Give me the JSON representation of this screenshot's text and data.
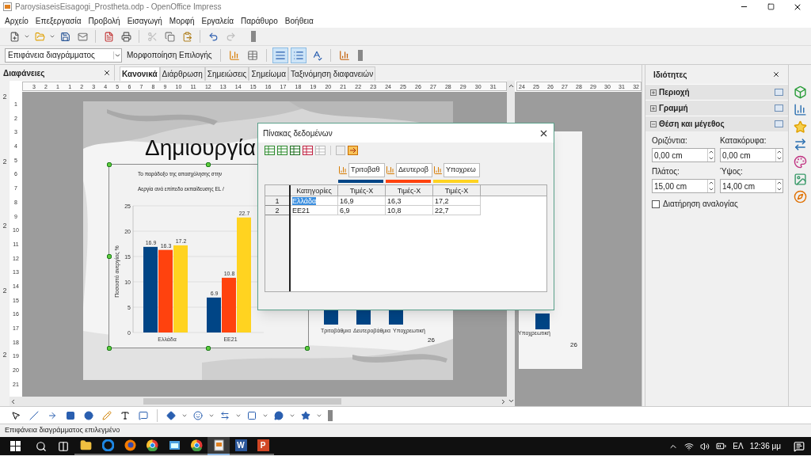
{
  "window": {
    "title": "ParoysiaseisEisagogi_Prostheta.odp - OpenOffice Impress"
  },
  "menu": [
    "Αρχείο",
    "Επεξεργασία",
    "Προβολή",
    "Εισαγωγή",
    "Μορφή",
    "Εργαλεία",
    "Παράθυρο",
    "Βοήθεια"
  ],
  "format_toolbar": {
    "object_select": "Επιφάνεια διαγράμματος",
    "format_selection": "Μορφοποίηση Επιλογής",
    "toggles": [
      {
        "kind": "chart-type",
        "selected": false
      },
      {
        "kind": "data-table",
        "selected": false
      },
      {
        "kind": "horizontal-grid",
        "selected": true
      },
      {
        "kind": "legend",
        "selected": true
      },
      {
        "kind": "text-scale",
        "selected": false
      },
      {
        "kind": "chart-wizard",
        "selected": false
      }
    ]
  },
  "slides_pane": {
    "title": "Διαφάνειες",
    "slide_numbers": [
      "2",
      "2",
      "2",
      "2",
      "2"
    ]
  },
  "view_tabs": [
    {
      "label": "Κανονικά",
      "selected": true
    },
    {
      "label": "Διάρθρωση",
      "selected": false
    },
    {
      "label": "Σημειώσεις",
      "selected": false
    },
    {
      "label": "Σημείωμα",
      "selected": false
    },
    {
      "label": "Ταξινόμηση διαφανειών",
      "selected": false
    }
  ],
  "ruler_h": [
    "3",
    "2",
    "1",
    "1",
    "2",
    "3",
    "4",
    "5",
    "6",
    "7",
    "8",
    "9",
    "10",
    "11",
    "12",
    "13",
    "14",
    "15",
    "16",
    "17",
    "18",
    "19",
    "20",
    "21",
    "22",
    "23",
    "24",
    "25",
    "26",
    "27",
    "28",
    "29",
    "30",
    "31"
  ],
  "ruler_v": [
    "1",
    "2",
    "3",
    "4",
    "5",
    "6",
    "7",
    "8",
    "9",
    "10",
    "11",
    "12",
    "13",
    "14",
    "15",
    "16",
    "17",
    "18",
    "19",
    "20",
    "21"
  ],
  "slide": {
    "title": "Δημιουργία",
    "chart": {
      "title": "Το παράδοξο της απασχόλησης στην",
      "subtitle": "Αεργία ανά επίπεδο εκπαίδευσης EL /",
      "chart_data": {
        "type": "bar",
        "ylabel": "Ποσοστό ανεργίας %",
        "categories": [
          "Ελλάδα",
          "ΕΕ21"
        ],
        "ylim": [
          0,
          25
        ],
        "yticks": [
          0,
          5,
          10,
          15,
          20,
          25
        ],
        "data_labels": true,
        "grid": true,
        "series": [
          {
            "color": "#004586",
            "values": [
              16.9,
              6.9
            ]
          },
          {
            "color": "#ff420e",
            "values": [
              16.3,
              10.8
            ]
          },
          {
            "color": "#ffd320",
            "values": [
              17.2,
              22.7
            ]
          }
        ]
      }
    },
    "second_chart": {
      "categories": [
        "Τριτοβάθμια",
        "Δευτεροβάθμια",
        "Υποχρεωτική"
      ],
      "page_number": "26"
    }
  },
  "second_view": {
    "ruler": [
      "24",
      "25",
      "26",
      "27",
      "28",
      "29",
      "30",
      "31",
      "32"
    ],
    "category": "Υποχρεωτική",
    "page_number": "26"
  },
  "dialog": {
    "title": "Πίνακας δεδομένων",
    "first_column": "Κατηγορίες",
    "series": [
      {
        "name": "Τριτοβαθ",
        "color": "#004586",
        "column_label": "Τιμές-Χ"
      },
      {
        "name": "Δευτεροβ",
        "color": "#ff420e",
        "column_label": "Τιμές-Χ"
      },
      {
        "name": "Υποχρεω",
        "color": "#ffd320",
        "column_label": "Τιμές-Χ"
      }
    ],
    "rows": [
      {
        "number": "1",
        "cells": [
          {
            "text": "Ελλάδα",
            "selected": true
          },
          {
            "text": "16,9",
            "selected": false
          },
          {
            "text": "16,3",
            "selected": false
          },
          {
            "text": "17,2",
            "selected": false
          }
        ]
      },
      {
        "number": "2",
        "cells": [
          {
            "text": "ΕΕ21",
            "selected": false
          },
          {
            "text": "6,9",
            "selected": false
          },
          {
            "text": "10,8",
            "selected": false
          },
          {
            "text": "22,7",
            "selected": false
          }
        ]
      }
    ]
  },
  "properties": {
    "title": "Ιδιότητες",
    "sections": [
      {
        "label": "Περιοχή",
        "expanded": false
      },
      {
        "label": "Γραμμή",
        "expanded": false
      },
      {
        "label": "Θέση και μέγεθος",
        "expanded": true
      }
    ],
    "fields": [
      {
        "label": "Οριζόντια:",
        "value": "0,00 cm"
      },
      {
        "label": "Κατακόρυφα:",
        "value": "0,00 cm"
      },
      {
        "label": "Πλάτος:",
        "value": "15,00 cm"
      },
      {
        "label": "Ύψος:",
        "value": "14,00 cm"
      }
    ],
    "keep_ratio": {
      "label": "Διατήρηση αναλογίας",
      "checked": false
    }
  },
  "status_bar": "Επιφάνεια διαγράμματος επιλεγμένο",
  "taskbar": {
    "apps": [
      {
        "kind": "folder",
        "selected": false
      },
      {
        "kind": "edge",
        "selected": false
      },
      {
        "kind": "firefox",
        "selected": false
      },
      {
        "kind": "chrome",
        "selected": false
      },
      {
        "kind": "window",
        "selected": false
      },
      {
        "kind": "chrome",
        "selected": false
      },
      {
        "kind": "impress",
        "selected": true
      },
      {
        "kind": "word",
        "glyph": "W",
        "selected": false
      },
      {
        "kind": "powerpoint",
        "glyph": "P",
        "selected": false
      }
    ],
    "language": "ΕΛ",
    "time": "12:36 μμ"
  }
}
